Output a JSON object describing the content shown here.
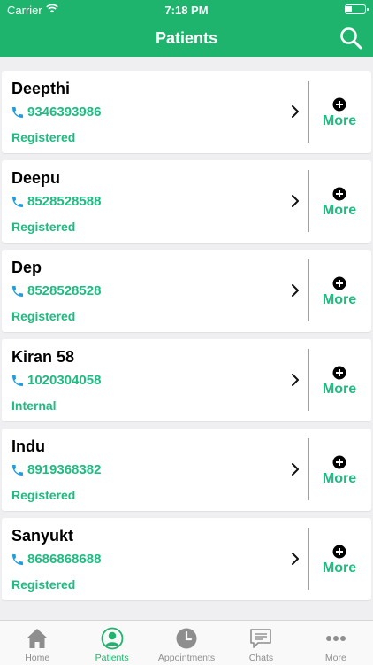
{
  "status_bar": {
    "carrier": "Carrier",
    "time": "7:18 PM"
  },
  "nav": {
    "title": "Patients",
    "search_icon": "search-icon"
  },
  "patients": [
    {
      "name": "Deepthi",
      "phone": "9346393986",
      "status": "Registered",
      "more_label": "More"
    },
    {
      "name": "Deepu",
      "phone": "8528528588",
      "status": "Registered",
      "more_label": "More"
    },
    {
      "name": "Dep",
      "phone": "8528528528",
      "status": "Registered",
      "more_label": "More"
    },
    {
      "name": "Kiran 58",
      "phone": "1020304058",
      "status": "Internal",
      "more_label": "More"
    },
    {
      "name": "Indu",
      "phone": "8919368382",
      "status": "Registered",
      "more_label": "More"
    },
    {
      "name": "Sanyukt",
      "phone": "8686868688",
      "status": "Registered",
      "more_label": "More"
    }
  ],
  "tabs": [
    {
      "label": "Home",
      "icon": "home-icon",
      "active": false
    },
    {
      "label": "Patients",
      "icon": "patient-icon",
      "active": true
    },
    {
      "label": "Appointments",
      "icon": "clock-icon",
      "active": false
    },
    {
      "label": "Chats",
      "icon": "chat-icon",
      "active": false
    },
    {
      "label": "More",
      "icon": "more-dots-icon",
      "active": false
    }
  ],
  "colors": {
    "brand": "#1fb46d",
    "accent_text": "#1ebc81",
    "background": "#efeff1",
    "inactive_tab": "#8e8e8e"
  }
}
